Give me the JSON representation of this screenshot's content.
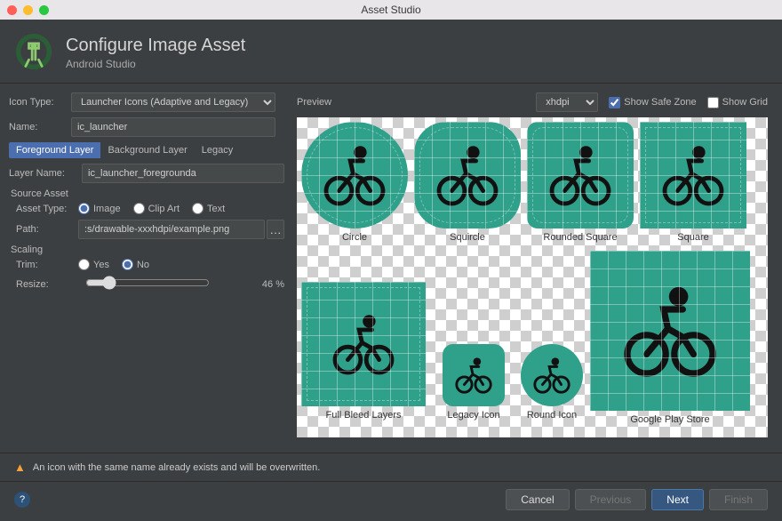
{
  "window": {
    "title": "Asset Studio"
  },
  "header": {
    "title": "Configure Image Asset",
    "subtitle": "Android Studio"
  },
  "form": {
    "icon_type_label": "Icon Type:",
    "icon_type_value": "Launcher Icons (Adaptive and Legacy)",
    "name_label": "Name:",
    "name_value": "ic_launcher",
    "tabs": {
      "foreground": "Foreground Layer",
      "background": "Background Layer",
      "legacy": "Legacy"
    },
    "layer_name_label": "Layer Name:",
    "layer_name_value": "ic_launcher_foregrounda",
    "source_asset_label": "Source Asset",
    "asset_type_label": "Asset Type:",
    "asset_type_options": {
      "image": "Image",
      "clipart": "Clip Art",
      "text": "Text"
    },
    "path_label": "Path:",
    "path_value": ":s/drawable-xxxhdpi/example.png",
    "scaling_label": "Scaling",
    "trim_label": "Trim:",
    "trim_options": {
      "yes": "Yes",
      "no": "No"
    },
    "resize_label": "Resize:",
    "resize_value": "46 %"
  },
  "preview": {
    "label": "Preview",
    "density_value": "xhdpi",
    "show_safe_zone_label": "Show Safe Zone",
    "show_grid_label": "Show Grid",
    "items": {
      "circle": "Circle",
      "squircle": "Squircle",
      "rounded_square": "Rounded Square",
      "square": "Square",
      "full_bleed": "Full Bleed Layers",
      "legacy_icon": "Legacy Icon",
      "round_icon": "Round Icon",
      "play_store": "Google Play Store"
    }
  },
  "warning": "An icon with the same name already exists and will be overwritten.",
  "buttons": {
    "cancel": "Cancel",
    "previous": "Previous",
    "next": "Next",
    "finish": "Finish"
  }
}
